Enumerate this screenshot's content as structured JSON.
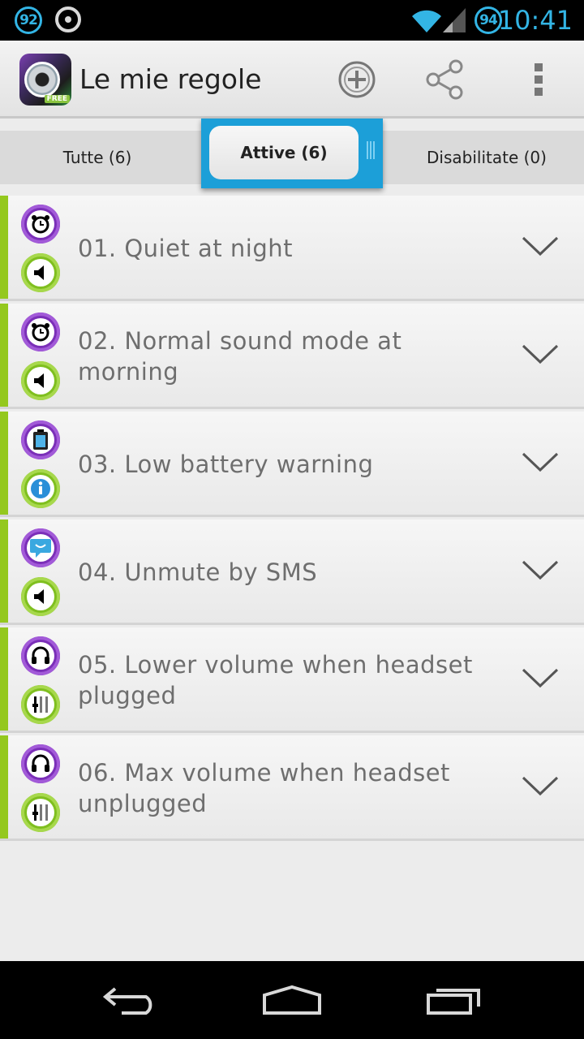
{
  "status_bar": {
    "badge_left": "92",
    "badge_right": "94",
    "time": "10:41"
  },
  "action_bar": {
    "title": "Le mie regole",
    "app_icon_badge": "FREE"
  },
  "tabs": [
    {
      "label": "Tutte (6)"
    },
    {
      "label": "Attive (6)",
      "active": true
    },
    {
      "label": "Disabilitate (0)"
    }
  ],
  "rules": [
    {
      "title": "01. Quiet at night",
      "trigger_icon": "alarm-clock-icon",
      "action_icon": "speaker-icon"
    },
    {
      "title": "02. Normal sound mode at morning",
      "trigger_icon": "alarm-clock-icon",
      "action_icon": "speaker-icon"
    },
    {
      "title": "03. Low battery warning",
      "trigger_icon": "battery-icon",
      "action_icon": "info-icon"
    },
    {
      "title": "04. Unmute by SMS",
      "trigger_icon": "sms-icon",
      "action_icon": "speaker-icon"
    },
    {
      "title": "05. Lower volume when headset plugged",
      "trigger_icon": "headset-icon",
      "action_icon": "volume-sliders-icon"
    },
    {
      "title": "06. Max volume when headset unplugged",
      "trigger_icon": "headset-icon",
      "action_icon": "volume-sliders-icon"
    }
  ],
  "colors": {
    "accent_blue": "#33b5e5",
    "tab_highlight": "#1c9fd8",
    "rule_accent": "#94c81e",
    "trigger_purple": "#7b2fb8",
    "action_green": "#7fbf1f"
  }
}
